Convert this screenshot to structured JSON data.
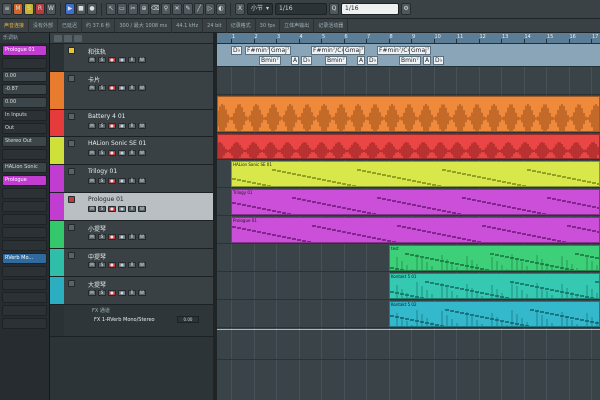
{
  "toolbar": {
    "buttons_left": [
      "≡",
      "M",
      "S",
      "R",
      "W"
    ],
    "transport": [
      "▶",
      "■",
      "●"
    ],
    "tool_icons": [
      "pointer",
      "range",
      "split",
      "glue",
      "erase",
      "zoom",
      "mute",
      "draw",
      "line",
      "play",
      "color"
    ],
    "snap_value": "1/16",
    "grid_type": "小节",
    "quantize_value": "1/16",
    "snap_label": "X",
    "quantize_label": "Q"
  },
  "infobar": {
    "cells": [
      "声音连接",
      "没有外部",
      "已延迟",
      "约 37.6 秒",
      "300 / 最大 1008 ms",
      "44.1 kHz",
      "24 bit",
      "记录格式",
      "30 fps",
      "立体声输出",
      "记录活动器"
    ]
  },
  "inspector": {
    "header": "乐调轨",
    "rows": [
      {
        "label": "Prologue 01",
        "style": "magenta"
      },
      {
        "label": "",
        "style": "dark"
      },
      {
        "label": "0.00",
        "style": "normal"
      },
      {
        "label": "-0.87",
        "style": "normal"
      },
      {
        "label": "0.00",
        "style": "normal"
      },
      {
        "label": "In Inputs",
        "style": "dark"
      },
      {
        "label": "Out",
        "style": "dark"
      },
      {
        "label": "Stereo Out",
        "style": "normal"
      },
      {
        "label": "",
        "style": "dark"
      },
      {
        "label": "HALion Sonic",
        "style": "normal"
      },
      {
        "label": "Prologue",
        "style": "magenta"
      },
      {
        "label": "",
        "style": "dark"
      },
      {
        "label": "",
        "style": "dark"
      },
      {
        "label": "",
        "style": "dark"
      },
      {
        "label": "",
        "style": "dark"
      },
      {
        "label": "",
        "style": "dark"
      },
      {
        "label": "RVerb Mo...",
        "style": "blue"
      },
      {
        "label": "",
        "style": "dark"
      },
      {
        "label": "",
        "style": "dark"
      },
      {
        "label": "",
        "style": "dark"
      },
      {
        "label": "",
        "style": "dark"
      },
      {
        "label": "",
        "style": "dark"
      }
    ]
  },
  "tracks": [
    {
      "name": "和弦轨",
      "color": "#2b3236",
      "height": 28,
      "kind": "chord",
      "icon": "yellow"
    },
    {
      "name": "卡片",
      "color": "#e97b2e",
      "height": 38,
      "kind": "audio",
      "icon": "normal"
    },
    {
      "name": "Battery 4 01",
      "color": "#e63b3b",
      "height": 27,
      "kind": "instrument",
      "icon": "normal"
    },
    {
      "name": "HALion Sonic SE 01",
      "color": "#cfe03a",
      "height": 28,
      "kind": "instrument",
      "icon": "normal"
    },
    {
      "name": "Trilogy 01",
      "color": "#c13cd0",
      "height": 28,
      "kind": "instrument",
      "icon": "normal"
    },
    {
      "name": "Prologue 01",
      "color": "#c13cd0",
      "height": 28,
      "kind": "instrument",
      "icon": "red",
      "selected": true
    },
    {
      "name": "小提琴",
      "color": "#35c76b",
      "height": 28,
      "kind": "instrument",
      "icon": "normal"
    },
    {
      "name": "中提琴",
      "color": "#2fbfa8",
      "height": 28,
      "kind": "instrument",
      "icon": "normal"
    },
    {
      "name": "大提琴",
      "color": "#2aaec0",
      "height": 28,
      "kind": "instrument",
      "icon": "normal"
    },
    {
      "name": "FX 通道",
      "color": "#2b3236",
      "height": 32,
      "kind": "fx",
      "icon": "normal",
      "fx_name": "FX 1-RVerb Mono/Stereo",
      "fx_value": "0.00"
    }
  ],
  "ruler": {
    "bars": [
      "1",
      "2",
      "3",
      "4",
      "5",
      "6",
      "7",
      "8",
      "9",
      "10",
      "11",
      "12",
      "13",
      "14",
      "15",
      "16",
      "17",
      "18",
      "19",
      "20"
    ]
  },
  "chords": [
    {
      "label": "D♭",
      "row": 0
    },
    {
      "label": "F#min⁷/C♯",
      "row": 0
    },
    {
      "label": "Bmin⁷",
      "row": 1
    },
    {
      "label": "Gmaj⁷",
      "row": 0
    },
    {
      "label": "A",
      "row": 1
    },
    {
      "label": "D♭",
      "row": 1
    },
    {
      "label": "F#min⁷/C♯",
      "row": 0
    },
    {
      "label": "Bmin⁷",
      "row": 1
    },
    {
      "label": "Gmaj⁷",
      "row": 0
    },
    {
      "label": "A",
      "row": 1
    },
    {
      "label": "D♭",
      "row": 1
    },
    {
      "label": "F#min⁷/C♯",
      "row": 0
    },
    {
      "label": "Bmin⁷",
      "row": 1
    },
    {
      "label": "Gmaj⁷",
      "row": 0
    },
    {
      "label": "A",
      "row": 1
    },
    {
      "label": "D♭",
      "row": 1
    }
  ],
  "clips": [
    {
      "lane": 1,
      "label": "",
      "color": "#ef8a3c",
      "dark": "#9a4a16"
    },
    {
      "lane": 2,
      "label": "",
      "color": "#ea4646",
      "dark": "#8a1c1c"
    },
    {
      "lane": 3,
      "label": "HALion Sonic SE 01",
      "color": "#d8e84a",
      "dark": "#7e8a17"
    },
    {
      "lane": 4,
      "label": "Trilogy 01",
      "color": "#cc4fd9",
      "dark": "#6b1a74"
    },
    {
      "lane": 5,
      "label": "Prologue 01",
      "color": "#cc4fd9",
      "dark": "#6b1a74"
    },
    {
      "lane": 6,
      "label": "test",
      "color": "#3ed079",
      "dark": "#17703c"
    },
    {
      "lane": 7,
      "label": "Kontakt 5 01",
      "color": "#35c9b2",
      "dark": "#136b5e"
    },
    {
      "lane": 8,
      "label": "Kontakt 5 02",
      "color": "#34b9cc",
      "dark": "#12606c"
    }
  ]
}
